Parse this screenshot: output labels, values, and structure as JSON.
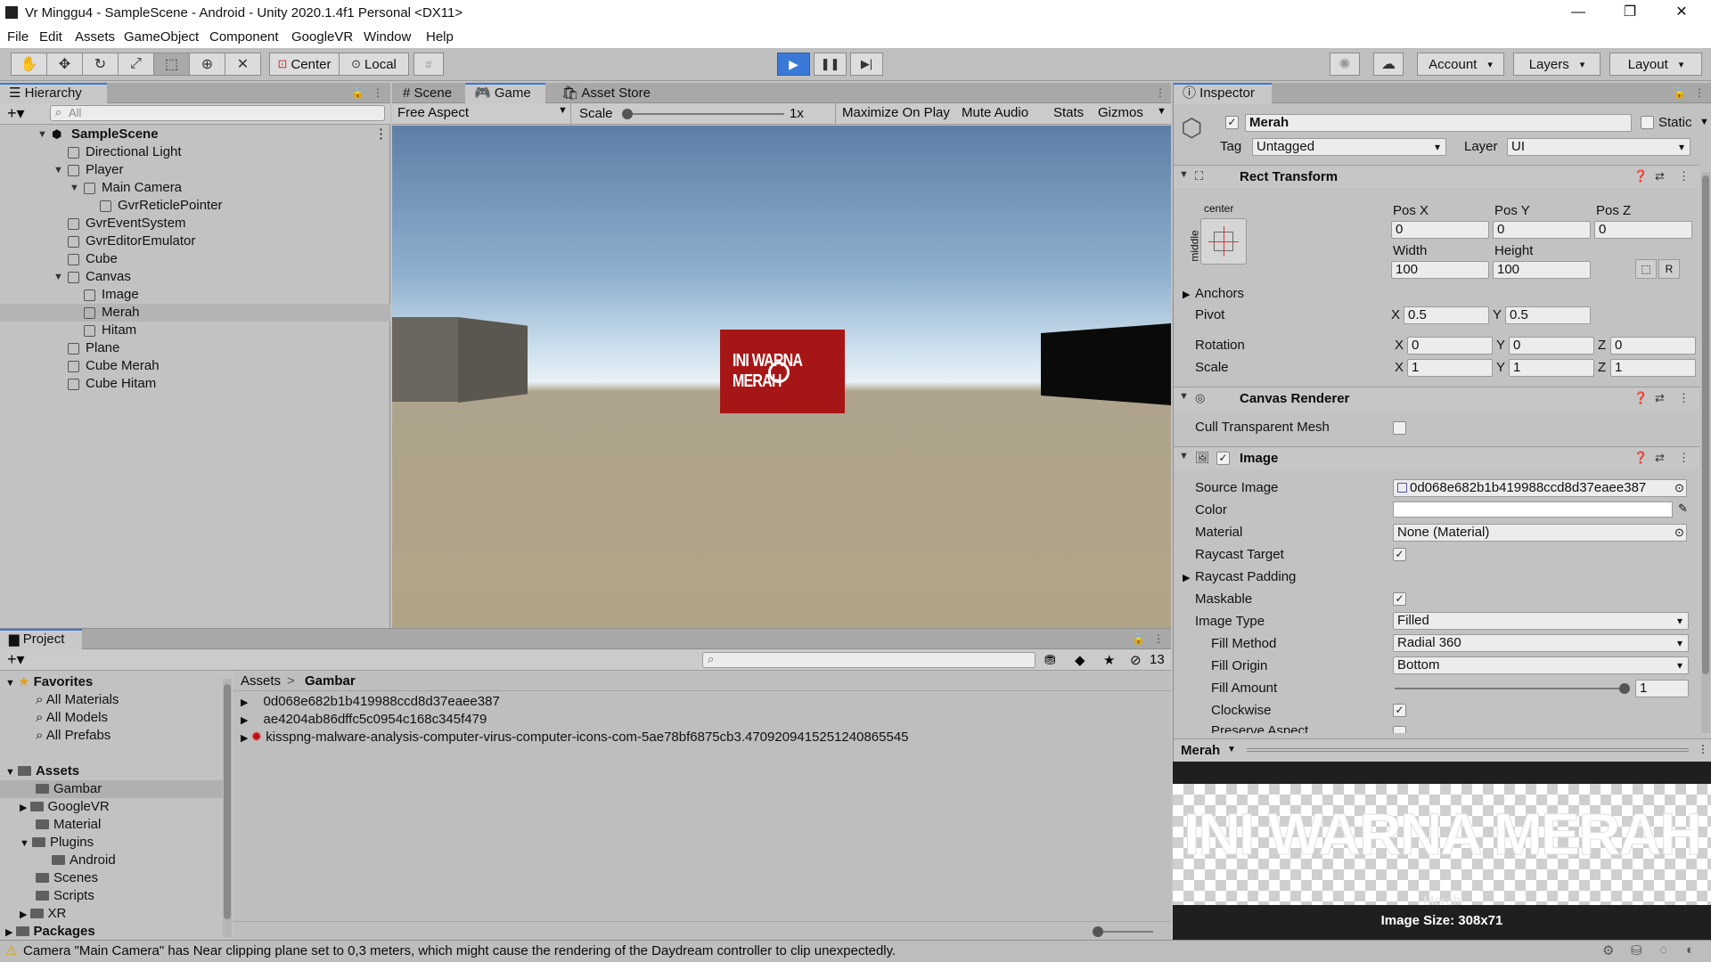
{
  "window": {
    "title": "Vr Minggu4 - SampleScene - Android - Unity 2020.1.4f1 Personal <DX11>",
    "minimize": "—",
    "maximize": "❐",
    "close": "✕"
  },
  "menu": [
    "File",
    "Edit",
    "Assets",
    "GameObject",
    "Component",
    "GoogleVR",
    "Window",
    "Help"
  ],
  "toolbar": {
    "pivot": "Center",
    "space": "Local",
    "account": "Account",
    "layers": "Layers",
    "layout": "Layout"
  },
  "hierarchy": {
    "tab": "Hierarchy",
    "search_placeholder": "All",
    "scene": "SampleScene",
    "items": [
      {
        "label": "Directional Light"
      },
      {
        "label": "Player"
      },
      {
        "label": "Main Camera"
      },
      {
        "label": "GvrReticlePointer"
      },
      {
        "label": "GvrEventSystem"
      },
      {
        "label": "GvrEditorEmulator"
      },
      {
        "label": "Cube"
      },
      {
        "label": "Canvas"
      },
      {
        "label": "Image"
      },
      {
        "label": "Merah"
      },
      {
        "label": "Hitam"
      },
      {
        "label": "Plane"
      },
      {
        "label": "Cube Merah"
      },
      {
        "label": "Cube Hitam"
      }
    ]
  },
  "game": {
    "tabs": [
      "Scene",
      "Game",
      "Asset Store"
    ],
    "aspect": "Free Aspect",
    "scale_label": "Scale",
    "scale_value": "1x",
    "scale_fraction": 0,
    "maximize": "Maximize On Play",
    "mute": "Mute Audio",
    "stats": "Stats",
    "gizmos": "Gizmos",
    "red_cube_text": "INI WARNA MERAH"
  },
  "inspector": {
    "tab": "Inspector",
    "object_name": "Merah",
    "static": "Static",
    "tag_label": "Tag",
    "tag_value": "Untagged",
    "layer_label": "Layer",
    "layer_value": "UI",
    "rect": {
      "title": "Rect Transform",
      "anchor_h": "center",
      "anchor_v": "middle",
      "pos_x_label": "Pos X",
      "pos_x": "0",
      "pos_y_label": "Pos Y",
      "pos_y": "0",
      "pos_z_label": "Pos Z",
      "pos_z": "0",
      "width_label": "Width",
      "width": "100",
      "height_label": "Height",
      "height": "100",
      "r_button": "R",
      "anchors": "Anchors",
      "pivot": "Pivot",
      "pivot_x": "0.5",
      "pivot_y": "0.5",
      "rotation": "Rotation",
      "rot_x": "0",
      "rot_y": "0",
      "rot_z": "0",
      "scale": "Scale",
      "scale_x": "1",
      "scale_y": "1",
      "scale_z": "1",
      "x": "X",
      "y": "Y",
      "z": "Z"
    },
    "canvas_renderer": {
      "title": "Canvas Renderer",
      "cull": "Cull Transparent Mesh"
    },
    "image": {
      "title": "Image",
      "source_label": "Source Image",
      "source_value": "0d068e682b1b419988ccd8d37eaee387",
      "color_label": "Color",
      "material_label": "Material",
      "material_value": "None (Material)",
      "raycast_target": "Raycast Target",
      "raycast_padding": "Raycast Padding",
      "maskable": "Maskable",
      "image_type_label": "Image Type",
      "image_type": "Filled",
      "fill_method_label": "Fill Method",
      "fill_method": "Radial 360",
      "fill_origin_label": "Fill Origin",
      "fill_origin": "Bottom",
      "fill_amount_label": "Fill Amount",
      "fill_amount": "1",
      "clockwise": "Clockwise",
      "preserve": "Preserve Aspect"
    }
  },
  "preview": {
    "name": "Merah",
    "text": "INI WARNA MERAH",
    "caption": "Merah",
    "size": "Image Size: 308x71"
  },
  "project": {
    "tab": "Project",
    "count": "13",
    "favorites": "Favorites",
    "fav_items": [
      "All Materials",
      "All Models",
      "All Prefabs"
    ],
    "assets": "Assets",
    "asset_folders": [
      {
        "label": "Gambar"
      },
      {
        "label": "GoogleVR"
      },
      {
        "label": "Material"
      },
      {
        "label": "Plugins"
      },
      {
        "label": "Android"
      },
      {
        "label": "Scenes"
      },
      {
        "label": "Scripts"
      },
      {
        "label": "XR"
      }
    ],
    "packages": "Packages",
    "breadcrumb_root": "Assets",
    "breadcrumb_sep": ">",
    "breadcrumb_current": "Gambar",
    "files": [
      "0d068e682b1b419988ccd8d37eaee387",
      "ae4204ab86dffc5c0954c168c345f479",
      "kisspng-malware-analysis-computer-virus-computer-icons-com-5ae78bf6875cb3.4709209415251240865545"
    ]
  },
  "status": {
    "message": "Camera \"Main Camera\" has Near clipping plane set to 0,3 meters, which might cause the rendering of the Daydream controller to clip unexpectedly."
  },
  "colors": {
    "accent": "#3a79d7",
    "red_cube": "#a71616",
    "play_active": "#3a79d7"
  }
}
